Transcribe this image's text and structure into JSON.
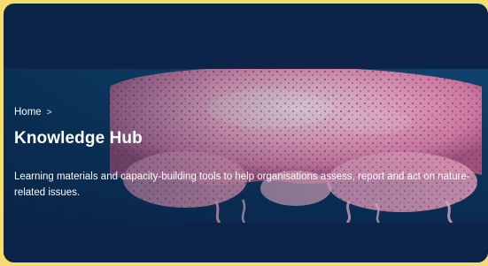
{
  "breadcrumb": {
    "home_label": "Home",
    "separator": ">"
  },
  "hero": {
    "title": "Knowledge Hub",
    "description": "Learning materials and capacity-building tools to help organisations assess, report and act on nature-related issues.",
    "image_icon": "jellyfish-image"
  },
  "colors": {
    "page_background": "#f5dc6c",
    "card_background": "#0b2447",
    "text": "#ffffff",
    "jellyfish_pink": "#f2a3c2"
  }
}
